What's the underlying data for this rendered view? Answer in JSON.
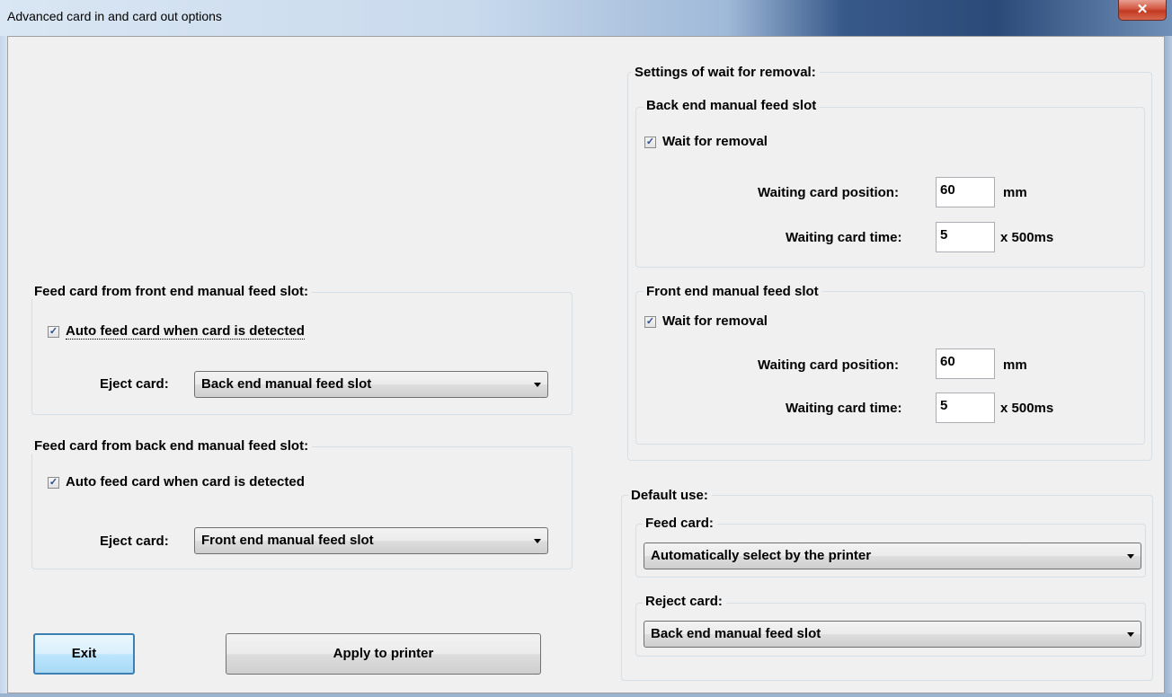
{
  "window": {
    "title": "Advanced card in and card out options",
    "close_glyph": "✕"
  },
  "front_feed": {
    "group_label": "Feed card from front end manual feed slot:",
    "auto_feed_label": "Auto feed card when card is detected",
    "auto_feed_checked": true,
    "eject_label": "Eject card:",
    "eject_value": "Back end manual feed slot"
  },
  "back_feed": {
    "group_label": "Feed card from back end manual feed slot:",
    "auto_feed_label": "Auto feed card when card is detected",
    "auto_feed_checked": true,
    "eject_label": "Eject card:",
    "eject_value": "Front end manual feed slot"
  },
  "wait_removal": {
    "group_label": "Settings of wait for removal:",
    "back": {
      "group_label": "Back end manual feed slot",
      "wait_label": "Wait for removal",
      "wait_checked": true,
      "position_label": "Waiting card position:",
      "position_value": "60",
      "position_unit": "mm",
      "time_label": "Waiting card time:",
      "time_value": "5",
      "time_unit": "x 500ms"
    },
    "front": {
      "group_label": "Front end manual feed slot",
      "wait_label": "Wait for removal",
      "wait_checked": true,
      "position_label": "Waiting card position:",
      "position_value": "60",
      "position_unit": "mm",
      "time_label": "Waiting card time:",
      "time_value": "5",
      "time_unit": "x 500ms"
    }
  },
  "default_use": {
    "group_label": "Default use:",
    "feed_label": "Feed card:",
    "feed_value": "Automatically select by the printer",
    "reject_label": "Reject card:",
    "reject_value": "Back end manual feed slot"
  },
  "buttons": {
    "exit": "Exit",
    "apply": "Apply to printer"
  },
  "icons": {
    "check": "checkmark-icon",
    "dropdown": "chevron-down-icon"
  }
}
